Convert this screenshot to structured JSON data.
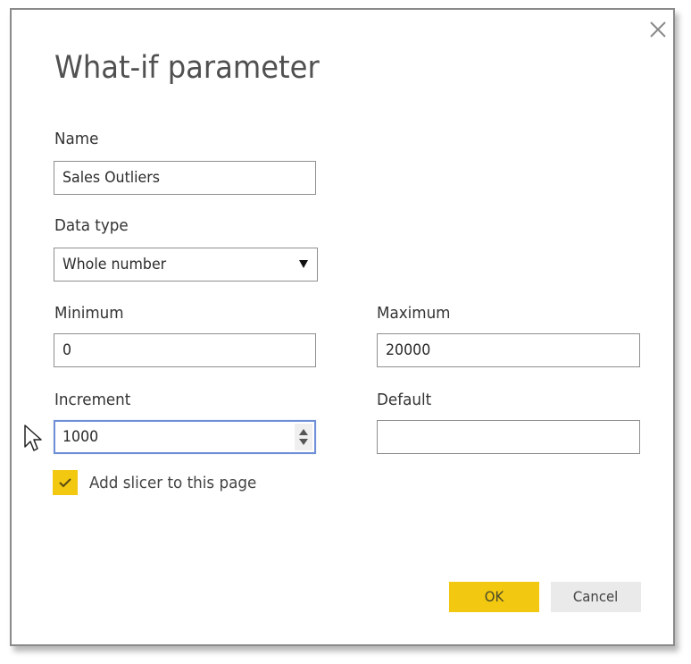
{
  "dialog": {
    "title": "What-if parameter",
    "close_icon": "close-icon"
  },
  "fields": {
    "name": {
      "label": "Name",
      "value": "Sales Outliers"
    },
    "data_type": {
      "label": "Data type",
      "value": "Whole number",
      "icon": "chevron-down-icon"
    },
    "minimum": {
      "label": "Minimum",
      "value": "0"
    },
    "maximum": {
      "label": "Maximum",
      "value": "20000"
    },
    "increment": {
      "label": "Increment",
      "value": "1000",
      "icon": "spinner-icon"
    },
    "default": {
      "label": "Default",
      "value": ""
    }
  },
  "checkbox": {
    "label": "Add slicer to this page",
    "checked": true,
    "color": "#f2c811"
  },
  "buttons": {
    "ok_label": "OK",
    "cancel_label": "Cancel"
  },
  "colors": {
    "accent": "#f2c811",
    "focus_border": "#6f8fd6"
  }
}
